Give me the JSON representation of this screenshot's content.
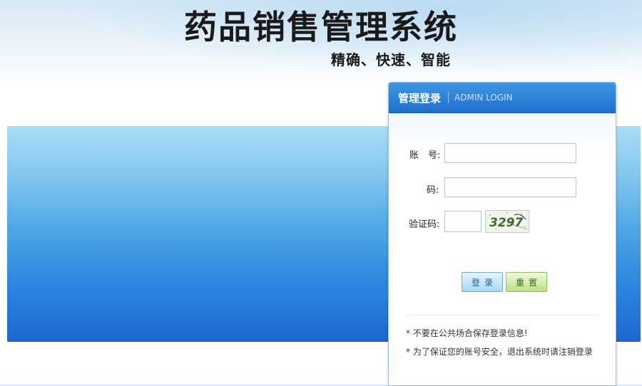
{
  "header": {
    "title": "药品销售管理系统",
    "slogan": "精确、快速、智能"
  },
  "login_panel": {
    "title": "管理登录",
    "subtitle": "ADMIN LOGIN",
    "account_label": "账　号:",
    "account_value": "",
    "password_label": "码:",
    "password_value": "",
    "captcha_label": "验证码:",
    "captcha_value": "",
    "captcha_text": "3297",
    "login_button": "登录",
    "reset_button": "重置",
    "notes": [
      "* 不要在公共场合保存登录信息!",
      "* 为了保证您的账号安全，退出系统时请注销登录"
    ]
  },
  "colors": {
    "header_blue": "#1f70cf",
    "banner_blue": "#2f8be0",
    "login_button": "#a8d8f6",
    "reset_button": "#b9e184",
    "captcha_text": "#3a6a2c"
  }
}
